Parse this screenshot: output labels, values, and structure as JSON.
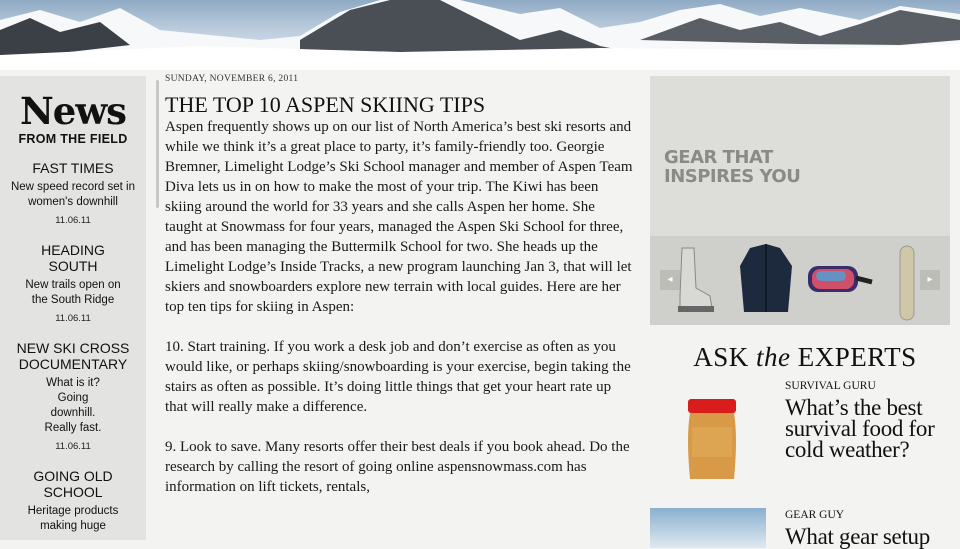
{
  "sidebar": {
    "title": "News",
    "subtitle": "FROM THE FIELD",
    "items": [
      {
        "heading": "FAST TIMES",
        "desc": "New speed record set in women's downhill",
        "date": "11.06.11"
      },
      {
        "heading": "HEADING SOUTH",
        "desc": "New trails open on the South Ridge",
        "date": "11.06.11"
      },
      {
        "heading": "NEW SKI CROSS DOCUMENTARY",
        "desc": "What is it? Going downhill. Really fast.",
        "date": "11.06.11"
      },
      {
        "heading": "GOING OLD SCHOOL",
        "desc": "Heritage products making huge",
        "date": ""
      }
    ]
  },
  "article": {
    "date": "SUNDAY, NOVEMBER 6, 2011",
    "title": "THE TOP 10 ASPEN SKIING TIPS",
    "paragraphs": [
      "Aspen frequently shows up on our list of North America’s best ski resorts and while we think it’s a great place to party, it’s family-friendly too. Georgie Bremner, Limelight Lodge’s Ski School manager and member of Aspen Team Diva lets us in on how to make the most of your trip. The Kiwi has been skiing around the world for 33 years and she calls Aspen her home. She taught at Snowmass for four years, managed the Aspen Ski School for three, and has been managing the Buttermilk School for two. She heads up the Limelight Lodge’s Inside Tracks, a new program launching Jan 3, that will let skiers and snowboarders explore new terrain with local guides. Here are her top ten tips for skiing in Aspen:",
      "10. Start training. If you work a desk job and don’t exercise as often as you would like, or perhaps skiing/snowboarding is your exercise, begin taking the stairs as often as possible. It’s doing little things that get your heart rate up that will really make a difference.",
      "9. Look to save. Many resorts offer their best deals if you book ahead. Do the research by calling the resort of going online aspensnowmass.com has information on lift tickets, rentals,"
    ]
  },
  "gear": {
    "title_line1": "GEAR THAT",
    "title_line2": "INSPIRES YOU",
    "prev_icon": "◂",
    "next_icon": "▸"
  },
  "experts": {
    "title_pre": "ASK ",
    "title_em": "the",
    "title_post": " EXPERTS",
    "items": [
      {
        "label": "SURVIVAL GURU",
        "question": "What’s the best survival food for cold weather?"
      },
      {
        "label": "GEAR GUY",
        "question": "What gear setup"
      }
    ]
  }
}
